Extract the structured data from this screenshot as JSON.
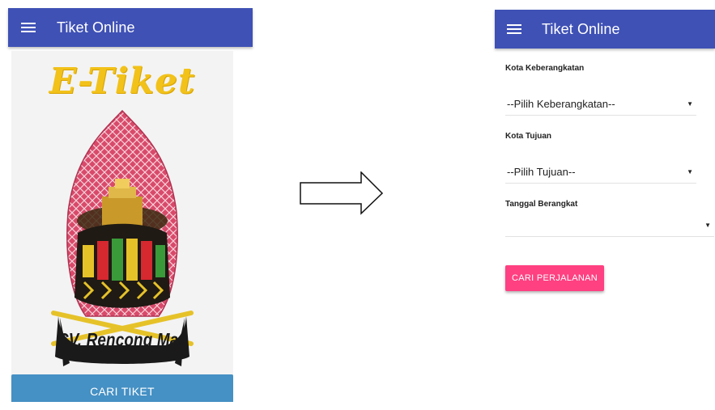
{
  "left_screen": {
    "app_title": "Tiket Online",
    "brand_text": "E-Tiket",
    "company_name": "CV. Rencong Mas",
    "cari_tiket_label": "CARI TIKET"
  },
  "right_screen": {
    "app_title": "Tiket Online",
    "departure": {
      "label": "Kota Keberangkatan",
      "value": "--Pilih Keberangkatan--"
    },
    "destination": {
      "label": "Kota Tujuan",
      "value": "--Pilih Tujuan--"
    },
    "date": {
      "label": "Tanggal Berangkat",
      "value": ""
    },
    "search_button_label": "CARI PERJALANAN"
  },
  "colors": {
    "appbar": "#3f51b5",
    "cari_tiket_button": "#4590c4",
    "cari_perjalanan_button": "#ff4081",
    "brand_yellow": "#f2c21a"
  },
  "icons": {
    "menu": "hamburger-menu-icon",
    "dropdown": "caret-down-icon",
    "transition": "arrow-right-icon"
  }
}
